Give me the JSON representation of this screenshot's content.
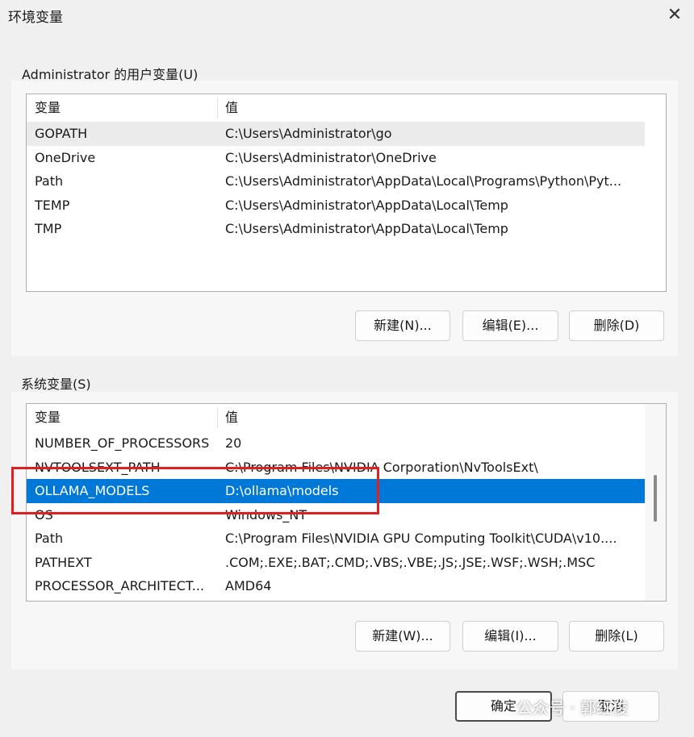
{
  "window": {
    "title": "环境变量",
    "close_glyph": "✕"
  },
  "user_vars": {
    "group_label": "Administrator 的用户变量(U)",
    "columns": [
      "变量",
      "值"
    ],
    "rows": [
      {
        "name": "GOPATH",
        "value": "C:\\Users\\Administrator\\go"
      },
      {
        "name": "OneDrive",
        "value": "C:\\Users\\Administrator\\OneDrive"
      },
      {
        "name": "Path",
        "value": "C:\\Users\\Administrator\\AppData\\Local\\Programs\\Python\\Pyt..."
      },
      {
        "name": "TEMP",
        "value": "C:\\Users\\Administrator\\AppData\\Local\\Temp"
      },
      {
        "name": "TMP",
        "value": "C:\\Users\\Administrator\\AppData\\Local\\Temp"
      }
    ],
    "buttons": {
      "new": "新建(N)...",
      "edit": "编辑(E)...",
      "delete": "删除(D)"
    }
  },
  "system_vars": {
    "group_label": "系统变量(S)",
    "columns": [
      "变量",
      "值"
    ],
    "rows": [
      {
        "name": "NUMBER_OF_PROCESSORS",
        "value": "20"
      },
      {
        "name": "NVTOOLSEXT_PATH",
        "value": "C:\\Program Files\\NVIDIA Corporation\\NvToolsExt\\"
      },
      {
        "name": "OLLAMA_MODELS",
        "value": "D:\\ollama\\models"
      },
      {
        "name": "OS",
        "value": "Windows_NT"
      },
      {
        "name": "Path",
        "value": "C:\\Program Files\\NVIDIA GPU Computing Toolkit\\CUDA\\v10...."
      },
      {
        "name": "PATHEXT",
        "value": ".COM;.EXE;.BAT;.CMD;.VBS;.VBE;.JS;.JSE;.WSF;.WSH;.MSC"
      },
      {
        "name": "PROCESSOR_ARCHITECT...",
        "value": "AMD64"
      }
    ],
    "buttons": {
      "new": "新建(W)...",
      "edit": "编辑(I)...",
      "delete": "删除(L)"
    }
  },
  "footer": {
    "ok": "确定",
    "cancel": "取消"
  },
  "watermark": "公众号 · 郭红俊",
  "colors": {
    "selection": "#0078d7",
    "highlight_box": "#e02020"
  }
}
